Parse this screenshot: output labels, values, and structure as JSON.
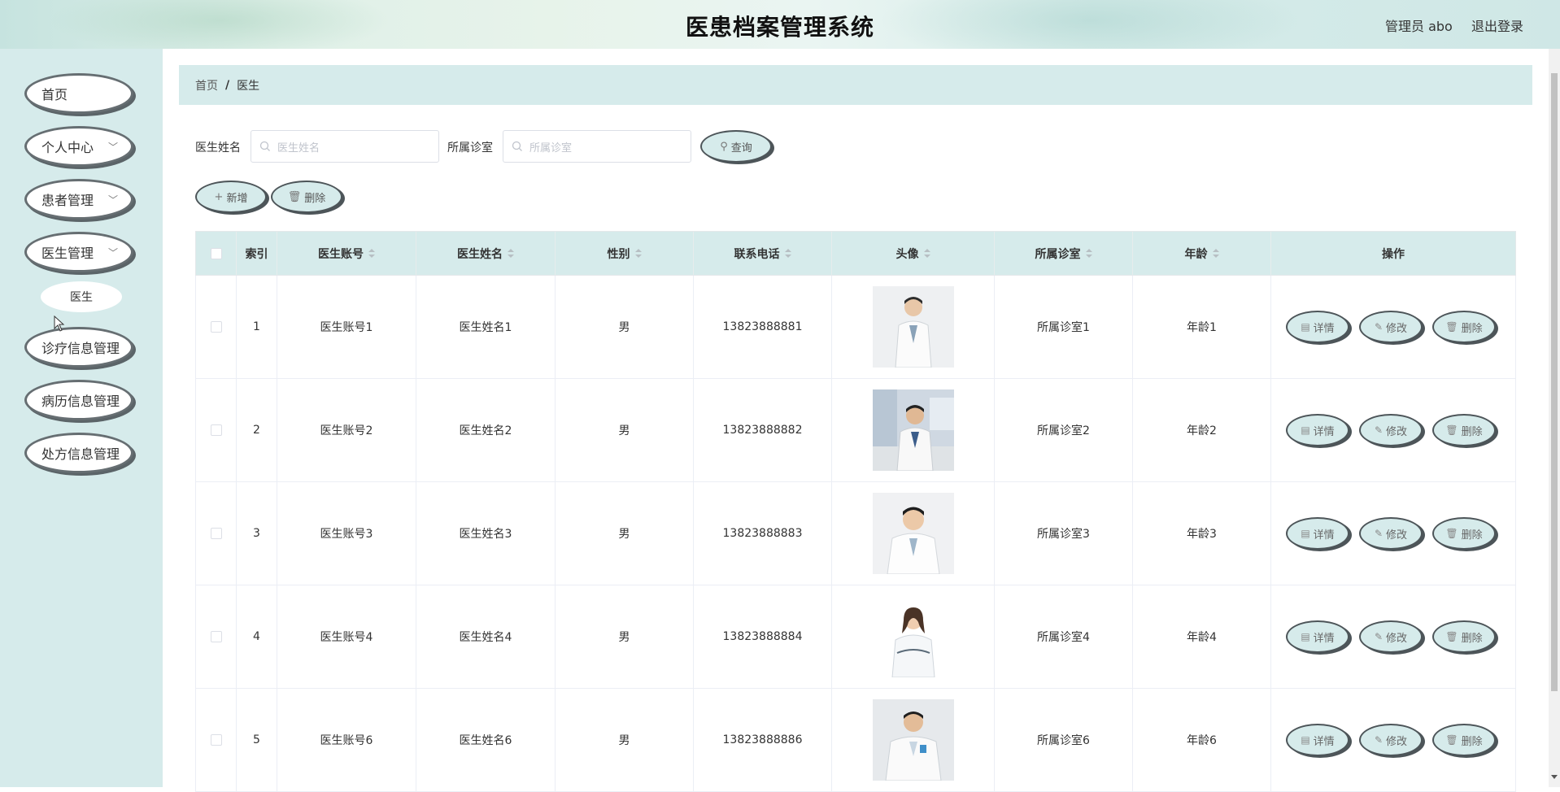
{
  "header": {
    "title": "医患档案管理系统",
    "user_label": "管理员 abo",
    "logout_label": "退出登录"
  },
  "sidebar": {
    "items": [
      {
        "label": "首页",
        "expandable": false
      },
      {
        "label": "个人中心",
        "expandable": true
      },
      {
        "label": "患者管理",
        "expandable": true
      },
      {
        "label": "医生管理",
        "expandable": true,
        "expanded": true
      },
      {
        "label": "诊疗信息管理",
        "expandable": false
      },
      {
        "label": "病历信息管理",
        "expandable": false
      },
      {
        "label": "处方信息管理",
        "expandable": false
      }
    ],
    "subitem": {
      "label": "医生"
    }
  },
  "breadcrumb": {
    "home": "首页",
    "separator": "/",
    "current": "医生"
  },
  "search": {
    "doctor_name_label": "医生姓名",
    "doctor_name_placeholder": "医生姓名",
    "clinic_label": "所属诊室",
    "clinic_placeholder": "所属诊室",
    "query_label": "查询"
  },
  "toolbar": {
    "add_label": "新增",
    "delete_label": "删除"
  },
  "table": {
    "columns": [
      "索引",
      "医生账号",
      "医生姓名",
      "性别",
      "联系电话",
      "头像",
      "所属诊室",
      "年龄",
      "操作"
    ],
    "rows": [
      {
        "index": "1",
        "account": "医生账号1",
        "name": "医生姓名1",
        "gender": "男",
        "phone": "13823888881",
        "clinic": "所属诊室1",
        "age": "年龄1"
      },
      {
        "index": "2",
        "account": "医生账号2",
        "name": "医生姓名2",
        "gender": "男",
        "phone": "13823888882",
        "clinic": "所属诊室2",
        "age": "年龄2"
      },
      {
        "index": "3",
        "account": "医生账号3",
        "name": "医生姓名3",
        "gender": "男",
        "phone": "13823888883",
        "clinic": "所属诊室3",
        "age": "年龄3"
      },
      {
        "index": "4",
        "account": "医生账号4",
        "name": "医生姓名4",
        "gender": "男",
        "phone": "13823888884",
        "clinic": "所属诊室4",
        "age": "年龄4"
      },
      {
        "index": "5",
        "account": "医生账号6",
        "name": "医生姓名6",
        "gender": "男",
        "phone": "13823888886",
        "clinic": "所属诊室6",
        "age": "年龄6"
      }
    ],
    "actions": {
      "detail": "详情",
      "edit": "修改",
      "delete": "删除"
    }
  },
  "colors": {
    "accent": "#d6ebeb",
    "button_border": "#4d5559"
  }
}
